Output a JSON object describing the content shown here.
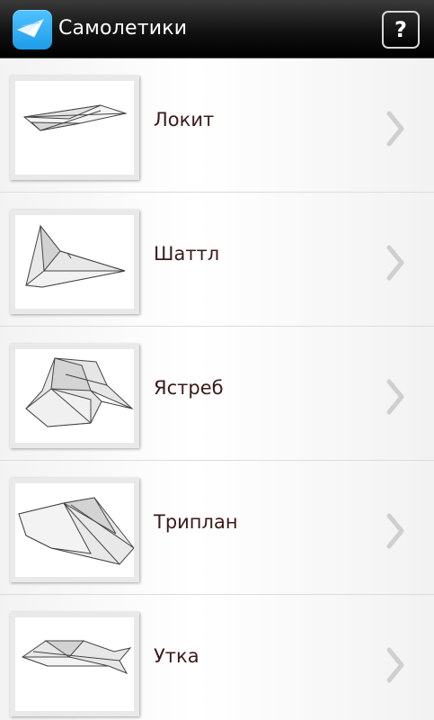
{
  "app": {
    "title": "Самолетики",
    "help_label": "?",
    "icon": "paper-plane-icon"
  },
  "list": {
    "items": [
      {
        "label": "Локит",
        "thumbnail": "lokit-plane-image"
      },
      {
        "label": "Шаттл",
        "thumbnail": "shuttle-plane-image"
      },
      {
        "label": "Ястреб",
        "thumbnail": "hawk-plane-image"
      },
      {
        "label": "Триплан",
        "thumbnail": "triplane-plane-image"
      },
      {
        "label": "Утка",
        "thumbnail": "duck-plane-image"
      }
    ]
  },
  "colors": {
    "actionbar": "#000000",
    "app_icon": "#1e9be8",
    "label_text": "#3b1a1a",
    "chevron": "#cfcfcf"
  }
}
